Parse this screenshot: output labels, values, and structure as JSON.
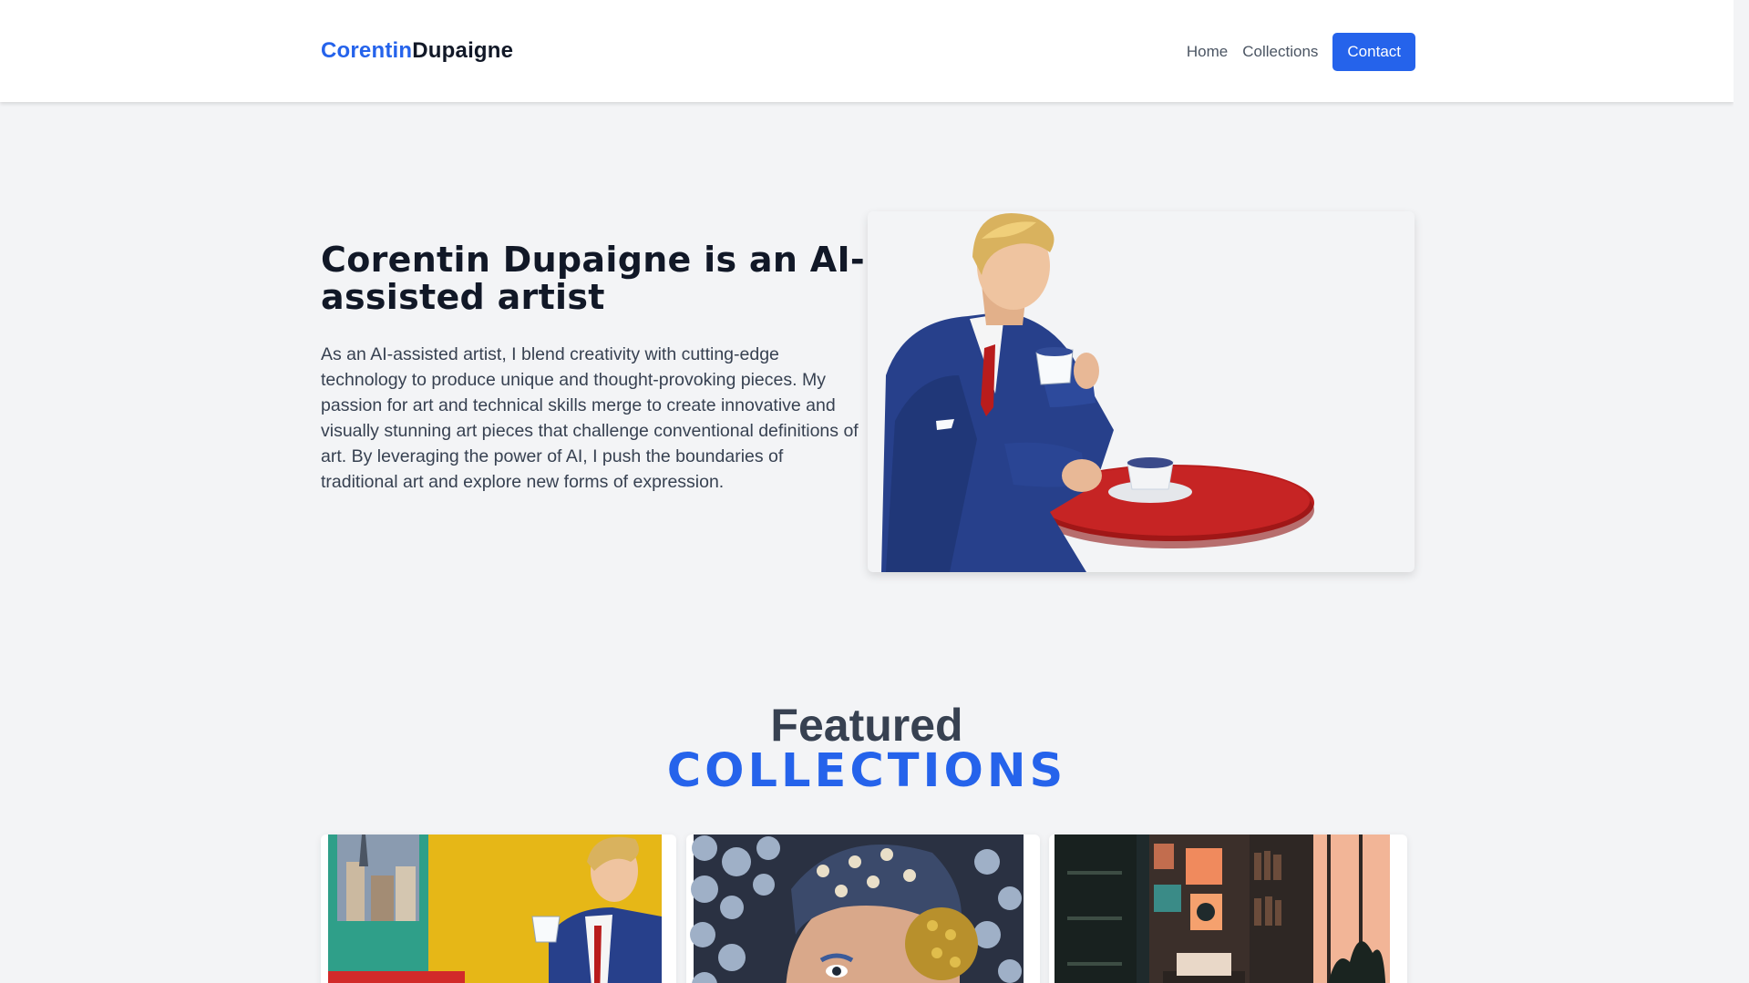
{
  "header": {
    "logo_first": "Corentin",
    "logo_last": "Dupaigne",
    "nav": {
      "home": "Home",
      "collections": "Collections",
      "contact": "Contact"
    }
  },
  "hero": {
    "title": "Corentin Dupaigne is an AI-assisted artist",
    "description": "As an AI-assisted artist, I blend creativity with cutting-edge technology to produce unique and thought-provoking pieces. My passion for art and technical skills merge to create innovative and visually stunning art pieces that challenge conventional definitions of art. By leveraging the power of AI, I push the boundaries of traditional art and explore new forms of expression."
  },
  "featured": {
    "title": "Featured",
    "subtitle": "COLLECTIONS"
  },
  "colors": {
    "accent": "#2563eb",
    "heading": "#111827",
    "body": "#374151",
    "background": "#f3f4f6"
  }
}
